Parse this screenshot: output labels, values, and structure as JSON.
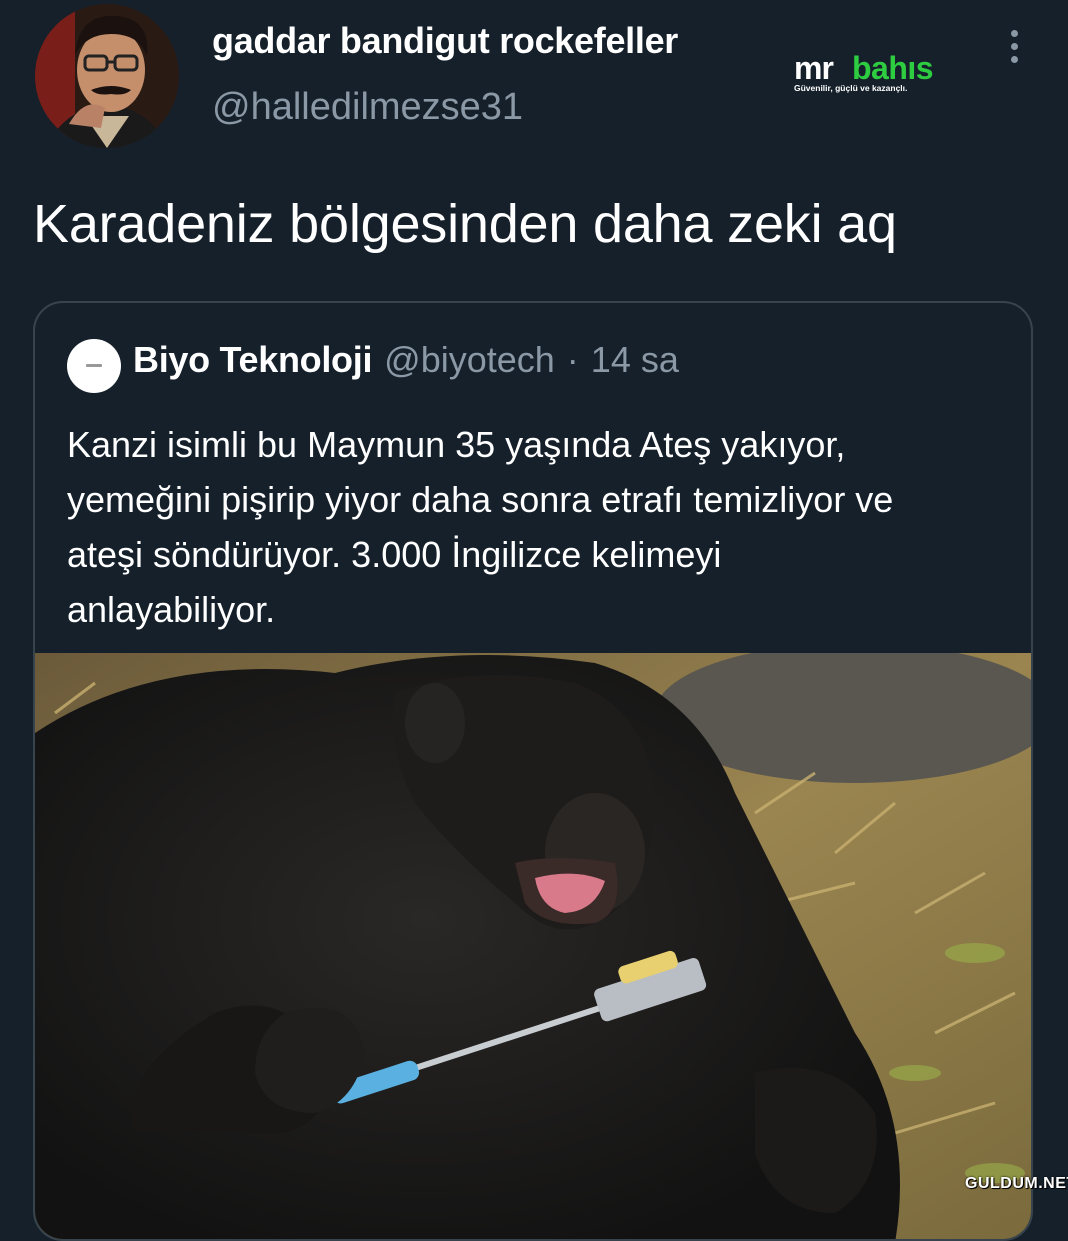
{
  "tweet": {
    "display_name": "gaddar bandigut rockefeller",
    "handle": "@halledilmezse31",
    "text": "Karadeniz bölgesinden daha zeki aq"
  },
  "ad_logo": {
    "mr": "mr",
    "bahis": "bahıs",
    "tagline": "Güvenilir, güçlü ve kazançlı.",
    "accent_color": "#2ecc40"
  },
  "quoted_tweet": {
    "display_name": "Biyo Teknoloji",
    "handle": "@biyotech",
    "separator": "·",
    "time": "14 sa",
    "text_lines": [
      "Kanzi isimli bu Maymun 35 yaşında Ateş yakıyor,",
      "yemeğini pişirip yiyor daha sonra etrafı temizliyor ve",
      "ateşi söndürüyor. 3.000 İngilizce kelimeyi",
      "anlayabiliyor."
    ]
  },
  "watermark": "GULDUM.NET",
  "colors": {
    "background": "#15202b",
    "secondary_text": "#8b98a5",
    "border": "#38444d"
  }
}
